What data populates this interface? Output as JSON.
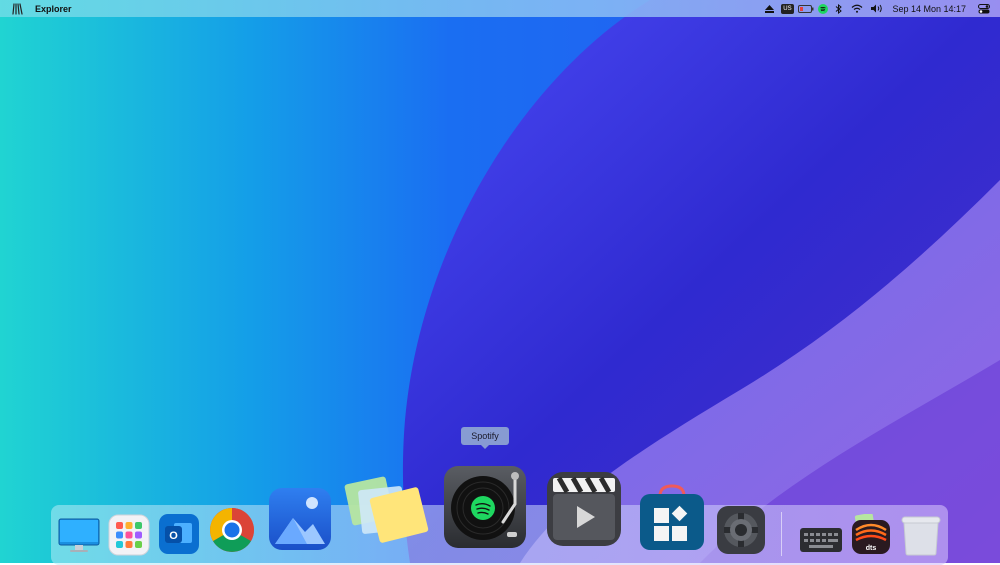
{
  "menubar": {
    "app_name": "Explorer",
    "keyboard_layout": "US",
    "clock": "Sep 14 Mon 14:17"
  },
  "dock": {
    "tooltip": "Spotify",
    "items": [
      {
        "icon": "desktop-monitor-icon"
      },
      {
        "icon": "launchpad-grid-icon"
      },
      {
        "icon": "outlook-icon",
        "glyph": "O"
      },
      {
        "icon": "chrome-icon"
      },
      {
        "icon": "photos-icon"
      },
      {
        "icon": "sticky-notes-icon"
      },
      {
        "icon": "spotify-turntable-icon"
      },
      {
        "icon": "video-clapper-icon"
      },
      {
        "icon": "app-store-bag-icon"
      },
      {
        "icon": "settings-gear-icon"
      },
      {
        "icon": "keyboard-icon"
      },
      {
        "icon": "dts-audio-icon",
        "glyph": "dts"
      },
      {
        "icon": "trash-icon"
      }
    ]
  },
  "colors": {
    "wallpaper_left": "#1fd0d6",
    "wallpaper_mid": "#1a70f0",
    "wallpaper_wave": "#3a2fd8",
    "wallpaper_right": "#8a4fe0",
    "spotify_green": "#1ed760"
  }
}
